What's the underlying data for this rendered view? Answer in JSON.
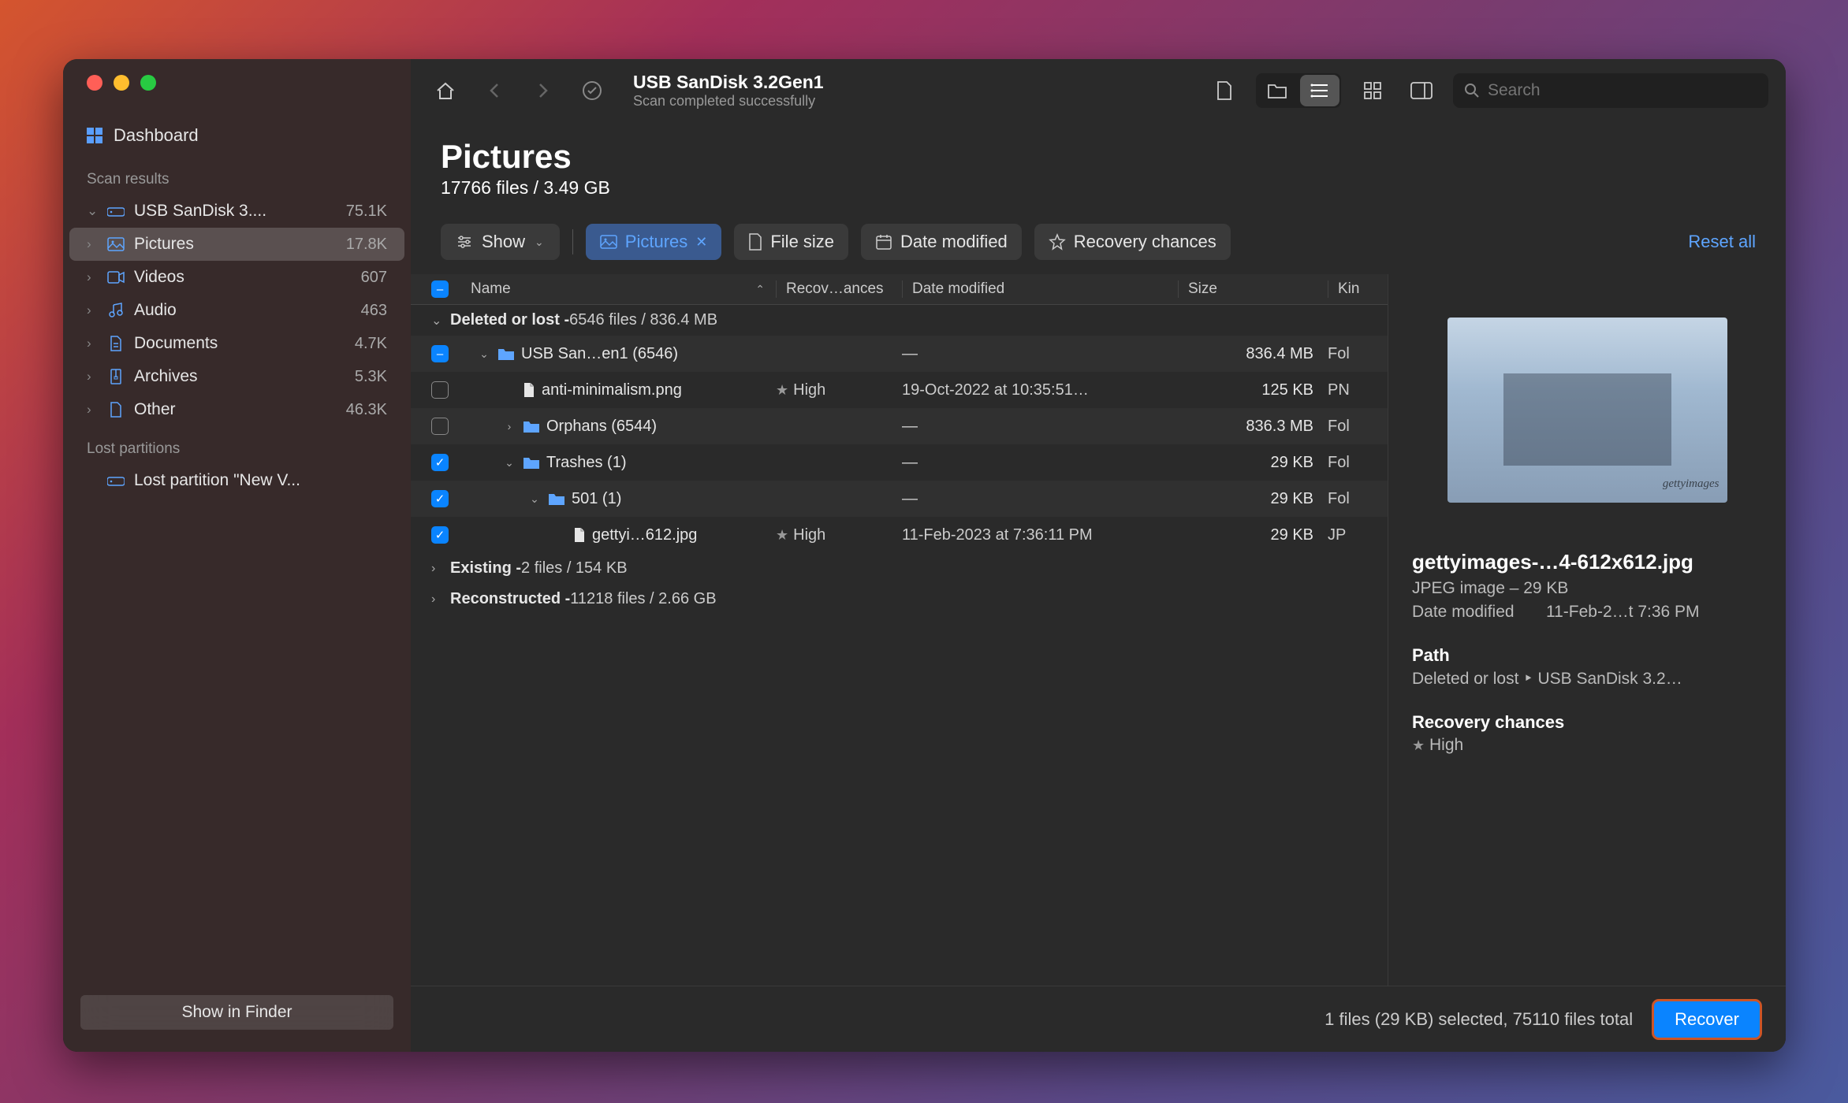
{
  "toolbar": {
    "title": "USB  SanDisk 3.2Gen1",
    "subtitle": "Scan completed successfully",
    "search_placeholder": "Search"
  },
  "sidebar": {
    "dashboard": "Dashboard",
    "scan_results_label": "Scan results",
    "items": [
      {
        "label": "USB  SanDisk 3....",
        "count": "75.1K",
        "icon": "drive"
      },
      {
        "label": "Pictures",
        "count": "17.8K",
        "icon": "picture",
        "selected": true
      },
      {
        "label": "Videos",
        "count": "607",
        "icon": "video"
      },
      {
        "label": "Audio",
        "count": "463",
        "icon": "audio"
      },
      {
        "label": "Documents",
        "count": "4.7K",
        "icon": "doc"
      },
      {
        "label": "Archives",
        "count": "5.3K",
        "icon": "archive"
      },
      {
        "label": "Other",
        "count": "46.3K",
        "icon": "other"
      }
    ],
    "lost_label": "Lost partitions",
    "lost_item": "Lost partition \"New V...",
    "show_finder": "Show in Finder"
  },
  "header": {
    "title": "Pictures",
    "subtitle": "17766 files / 3.49 GB"
  },
  "filters": {
    "show": "Show",
    "pictures": "Pictures",
    "file_size": "File size",
    "date_modified": "Date modified",
    "recovery": "Recovery chances",
    "reset": "Reset all"
  },
  "columns": {
    "name": "Name",
    "recovery": "Recov…ances",
    "date": "Date modified",
    "size": "Size",
    "kind": "Kin"
  },
  "sections": {
    "deleted": {
      "label": "Deleted or lost - ",
      "stats": "6546 files / 836.4 MB"
    },
    "existing": {
      "label": "Existing - ",
      "stats": "2 files / 154 KB"
    },
    "reconstructed": {
      "label": "Reconstructed - ",
      "stats": "11218 files / 2.66 GB"
    }
  },
  "rows": [
    {
      "check": "part",
      "indent": 1,
      "expand": "down",
      "icon": "folder",
      "name": "USB  San…en1 (6546)",
      "rec": "",
      "date": "—",
      "size": "836.4 MB",
      "kind": "Fol"
    },
    {
      "check": "none",
      "indent": 2,
      "expand": "",
      "icon": "file",
      "name": "anti-minimalism.png",
      "rec": "High",
      "date": "19-Oct-2022 at 10:35:51…",
      "size": "125 KB",
      "kind": "PN"
    },
    {
      "check": "none",
      "indent": 2,
      "expand": "right",
      "icon": "folder",
      "name": "Orphans (6544)",
      "rec": "",
      "date": "—",
      "size": "836.3 MB",
      "kind": "Fol"
    },
    {
      "check": "checked",
      "indent": 2,
      "expand": "down",
      "icon": "folder",
      "name": "Trashes (1)",
      "rec": "",
      "date": "—",
      "size": "29 KB",
      "kind": "Fol"
    },
    {
      "check": "checked",
      "indent": 3,
      "expand": "down",
      "icon": "folder",
      "name": "501 (1)",
      "rec": "",
      "date": "—",
      "size": "29 KB",
      "kind": "Fol"
    },
    {
      "check": "checked",
      "indent": 4,
      "expand": "",
      "icon": "file",
      "name": "gettyi…612.jpg",
      "rec": "High",
      "date": "11-Feb-2023 at 7:36:11 PM",
      "size": "29 KB",
      "kind": "JP"
    }
  ],
  "preview": {
    "title": "gettyimages-…4-612x612.jpg",
    "meta": "JPEG image – 29 KB",
    "date_k": "Date modified",
    "date_v": "11-Feb-2…t 7:36 PM",
    "path_label": "Path",
    "path_value": "Deleted or lost ‣ USB  SanDisk 3.2…",
    "rec_label": "Recovery chances",
    "rec_value": "High"
  },
  "footer": {
    "status": "1 files (29 KB) selected, 75110 files total",
    "recover": "Recover"
  }
}
